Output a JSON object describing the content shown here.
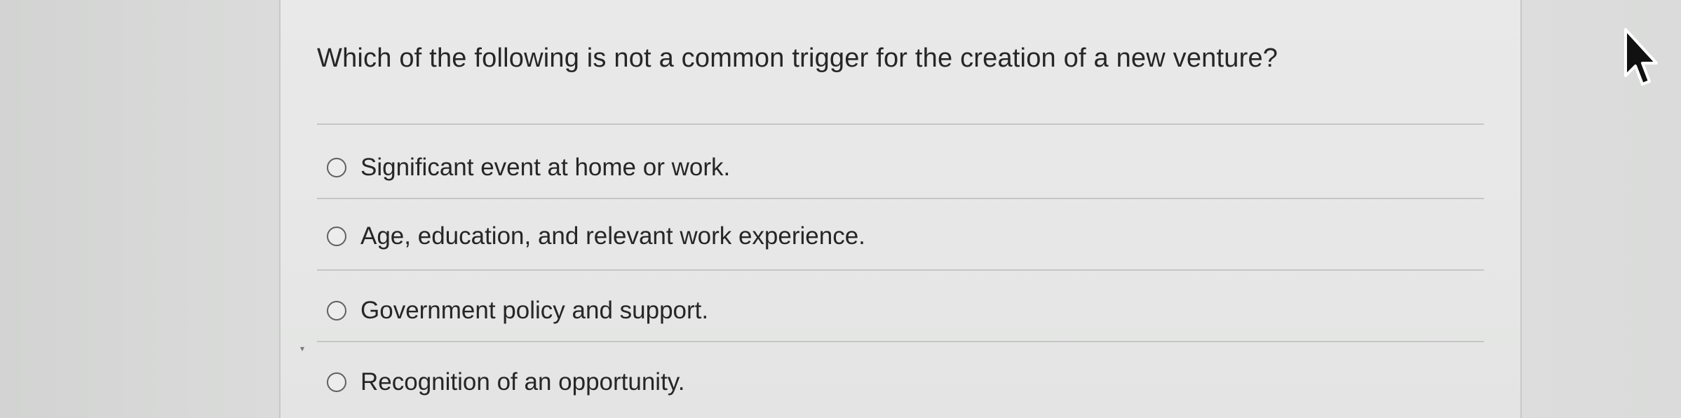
{
  "question": {
    "text": "Which of the following is not a common trigger for the creation of a new venture?"
  },
  "options": [
    {
      "label": "Significant event at home or work."
    },
    {
      "label": "Age, education, and relevant work experience."
    },
    {
      "label": "Government policy and support."
    },
    {
      "label": "Recognition of an opportunity."
    }
  ],
  "icons": {
    "radio": "radio-button-icon",
    "cursor": "mouse-pointer-icon"
  },
  "colors": {
    "text": "#262626",
    "radio_border": "#5f6061",
    "rule": "#c4c5c4"
  }
}
